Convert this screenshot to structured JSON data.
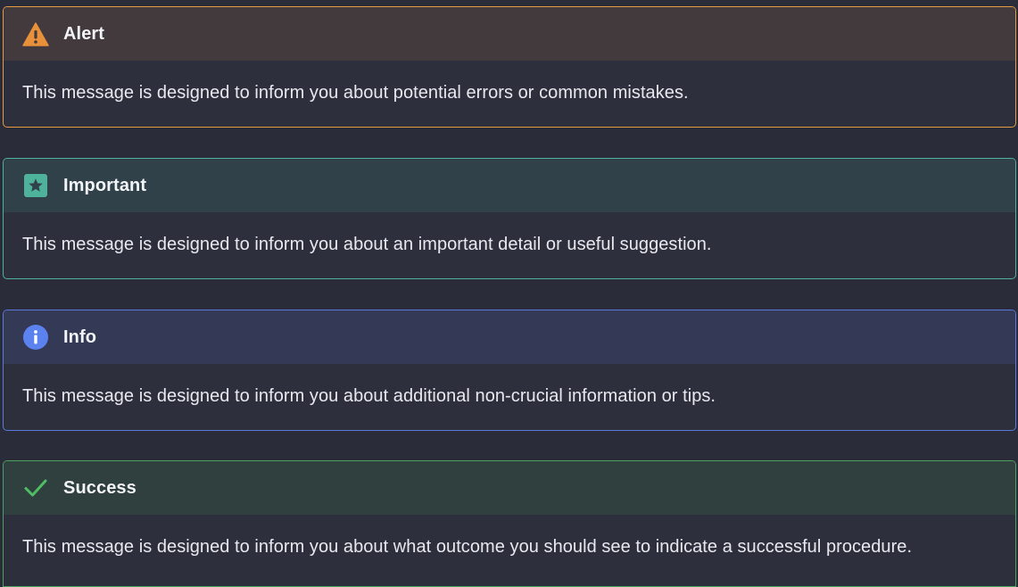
{
  "callouts": [
    {
      "type": "alert",
      "title": "Alert",
      "message": "This message is designed to inform you about potential errors or common mistakes.",
      "icon": "warning-triangle-icon",
      "accent_color": "#e79a3f"
    },
    {
      "type": "important",
      "title": "Important",
      "message": "This message is designed to inform you about an important detail or useful suggestion.",
      "icon": "star-icon",
      "accent_color": "#4fb39b"
    },
    {
      "type": "info",
      "title": "Info",
      "message": "This message is designed to inform you about additional non-crucial information or tips.",
      "icon": "info-icon",
      "accent_color": "#5a79dc"
    },
    {
      "type": "success",
      "title": "Success",
      "message": "This message is designed to inform you about what outcome you should see to indicate a successful procedure.",
      "icon": "checkmark-icon",
      "accent_color": "#4da25e"
    }
  ]
}
